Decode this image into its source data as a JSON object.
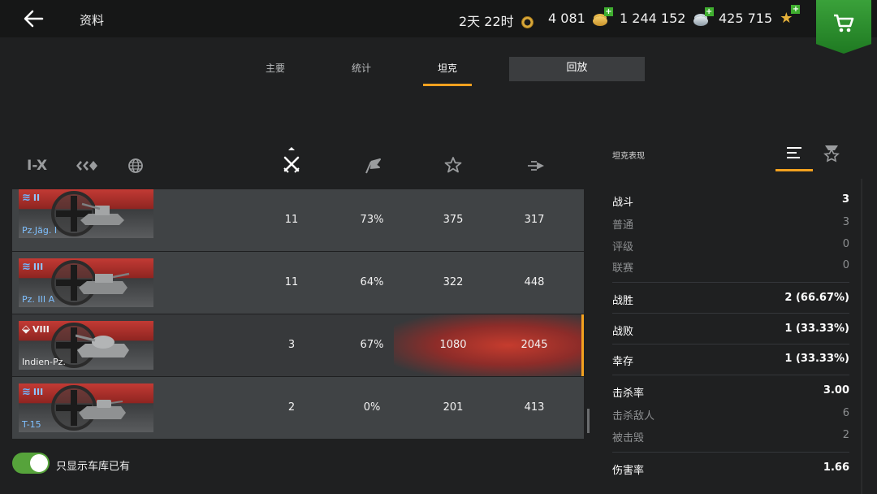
{
  "header": {
    "title": "资料",
    "timer": "2天 22时",
    "gold": "4 081",
    "silver": "1 244 152",
    "free_xp": "425 715",
    "plus": "+"
  },
  "tabs": [
    {
      "label": "主要"
    },
    {
      "label": "统计"
    },
    {
      "label": "坦克"
    },
    {
      "label": "回放"
    }
  ],
  "filters": {
    "tier_label": "I-X"
  },
  "tanks": [
    {
      "name": "Pz.Jäg. I",
      "tier": "II",
      "battles": "11",
      "winrate": "73%",
      "avg_xp": "375",
      "avg_damage": "317"
    },
    {
      "name": "Pz. III A",
      "tier": "III",
      "battles": "11",
      "winrate": "64%",
      "avg_xp": "322",
      "avg_damage": "448"
    },
    {
      "name": "Indien-Pz.",
      "tier": "VIII",
      "battles": "3",
      "winrate": "67%",
      "avg_xp": "1080",
      "avg_damage": "2045"
    },
    {
      "name": "T-15",
      "tier": "III",
      "battles": "2",
      "winrate": "0%",
      "avg_xp": "201",
      "avg_damage": "413"
    }
  ],
  "toggle": {
    "label": "只显示车库已有",
    "on": true
  },
  "right_panel": {
    "title": "坦克表现",
    "stats": [
      {
        "key": "战斗",
        "value": "3"
      },
      {
        "key": "普通",
        "value": "3"
      },
      {
        "key": "评级",
        "value": "0"
      },
      {
        "key": "联赛",
        "value": "0"
      },
      {
        "key": "战胜",
        "value": "2 (66.67%)"
      },
      {
        "key": "战败",
        "value": "1 (33.33%)"
      },
      {
        "key": "幸存",
        "value": "1 (33.33%)"
      },
      {
        "key": "击杀率",
        "value": "3.00"
      },
      {
        "key": "击杀敌人",
        "value": "6"
      },
      {
        "key": "被击毁",
        "value": "2"
      },
      {
        "key": "伤害率",
        "value": "1.66"
      }
    ]
  },
  "colors": {
    "accent": "#f2a11f",
    "toggle_on": "#56a33b",
    "shop": "#2a8d2c"
  }
}
